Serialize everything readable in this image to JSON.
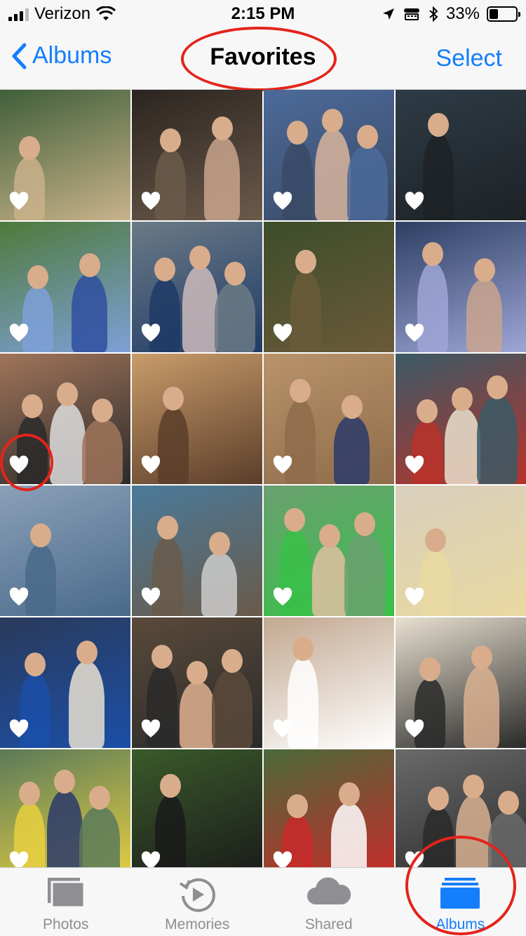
{
  "status": {
    "carrier": "Verizon",
    "time": "2:15 PM",
    "battery": "33%"
  },
  "nav": {
    "back_label": "Albums",
    "title": "Favorites",
    "select_label": "Select"
  },
  "photos": {
    "count": 24,
    "favorite_icon": "heart-icon"
  },
  "tabs": [
    {
      "label": "Photos",
      "icon": "photos-icon"
    },
    {
      "label": "Memories",
      "icon": "memories-icon"
    },
    {
      "label": "Shared",
      "icon": "cloud-icon"
    },
    {
      "label": "Albums",
      "icon": "albums-icon",
      "active": true
    }
  ],
  "colors": {
    "accent": "#147efb",
    "inactive": "#8e8e93",
    "annotation": "#e3241b"
  }
}
